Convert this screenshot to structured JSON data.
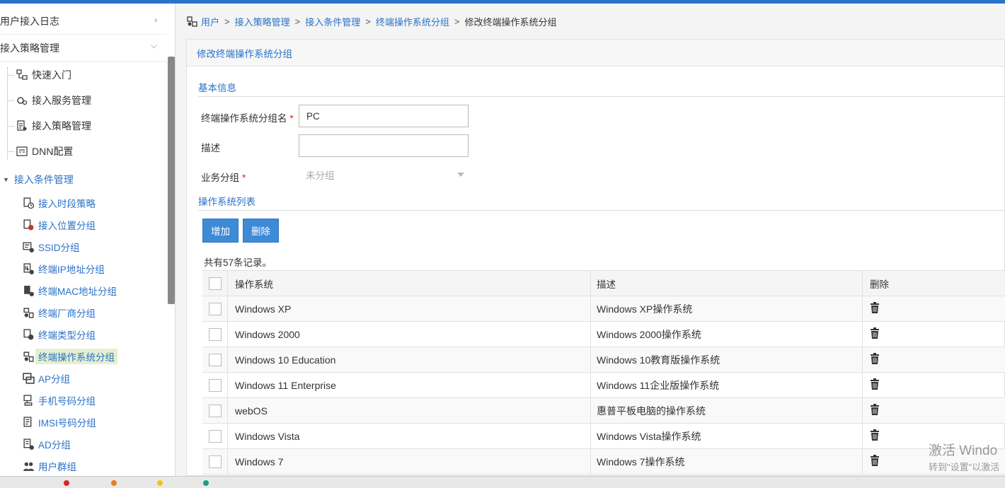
{
  "sidebar": {
    "groups": [
      {
        "label": "用户接入日志"
      },
      {
        "label": "接入策略管理"
      }
    ],
    "items": [
      {
        "label": "快速入门"
      },
      {
        "label": "接入服务管理"
      },
      {
        "label": "接入策略管理"
      },
      {
        "label": "DNN配置"
      }
    ],
    "condition_group": "接入条件管理",
    "sub_items": [
      {
        "label": "接入时段策略"
      },
      {
        "label": "接入位置分组"
      },
      {
        "label": "SSID分组"
      },
      {
        "label": "终端IP地址分组"
      },
      {
        "label": "终端MAC地址分组"
      },
      {
        "label": "终端厂商分组"
      },
      {
        "label": "终端类型分组"
      },
      {
        "label": "终端操作系统分组"
      },
      {
        "label": "AP分组"
      },
      {
        "label": "手机号码分组"
      },
      {
        "label": "IMSI号码分组"
      },
      {
        "label": "AD分组"
      },
      {
        "label": "用户群组"
      }
    ]
  },
  "breadcrumb": {
    "items": [
      "用户",
      "接入策略管理",
      "接入条件管理",
      "终端操作系统分组"
    ],
    "current": "修改终端操作系统分组",
    "separator": ">"
  },
  "panel": {
    "title": "修改终端操作系统分组",
    "basic_info": "基本信息",
    "name_label": "终端操作系统分组名",
    "name_value": "PC",
    "desc_label": "描述",
    "desc_value": "",
    "biz_label": "业务分组",
    "biz_value": "未分组",
    "required_mark": "*",
    "os_list_title": "操作系统列表",
    "add_button": "增加",
    "delete_button": "删除",
    "record_count": "共有57条记录。"
  },
  "table": {
    "headers": {
      "os": "操作系统",
      "desc": "描述",
      "del": "删除"
    },
    "rows": [
      {
        "os": "Windows XP",
        "desc": "Windows XP操作系统"
      },
      {
        "os": "Windows 2000",
        "desc": "Windows 2000操作系统"
      },
      {
        "os": "Windows 10 Education",
        "desc": "Windows 10教育版操作系统"
      },
      {
        "os": "Windows 11 Enterprise",
        "desc": "Windows 11企业版操作系统"
      },
      {
        "os": "webOS",
        "desc": "惠普平板电脑的操作系统"
      },
      {
        "os": "Windows Vista",
        "desc": "Windows Vista操作系统"
      },
      {
        "os": "Windows 7",
        "desc": "Windows 7操作系统"
      }
    ]
  },
  "watermark": {
    "line1": "激活 Windo",
    "line2": "转到\"设置\"以激活"
  },
  "colors": {
    "accent": "#2a72c8",
    "button": "#3d8ad6",
    "required": "#d9261c"
  }
}
